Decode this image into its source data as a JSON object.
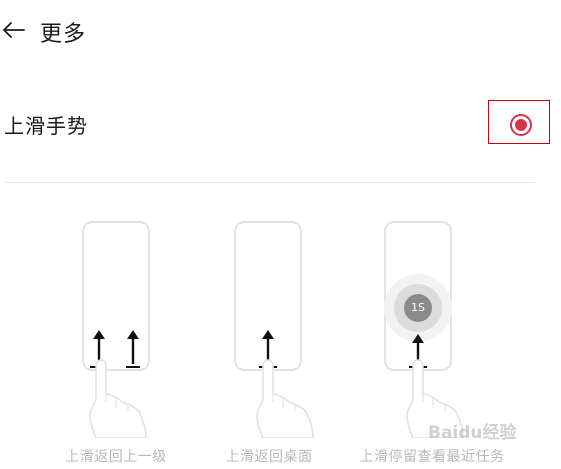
{
  "header": {
    "title": "更多",
    "back_icon": "arrow-left-icon"
  },
  "setting": {
    "label": "上滑手势",
    "selected": true,
    "accent_color": "#d8334a"
  },
  "gestures": [
    {
      "caption": "上滑返回上一级",
      "icon": "swipe-up-back-icon"
    },
    {
      "caption": "上滑返回桌面",
      "icon": "swipe-up-home-icon"
    },
    {
      "caption": "上滑停留查看最近任务",
      "icon": "swipe-up-hold-recents-icon",
      "badge": "1S"
    }
  ],
  "watermark": {
    "text": "Baidu经验"
  }
}
